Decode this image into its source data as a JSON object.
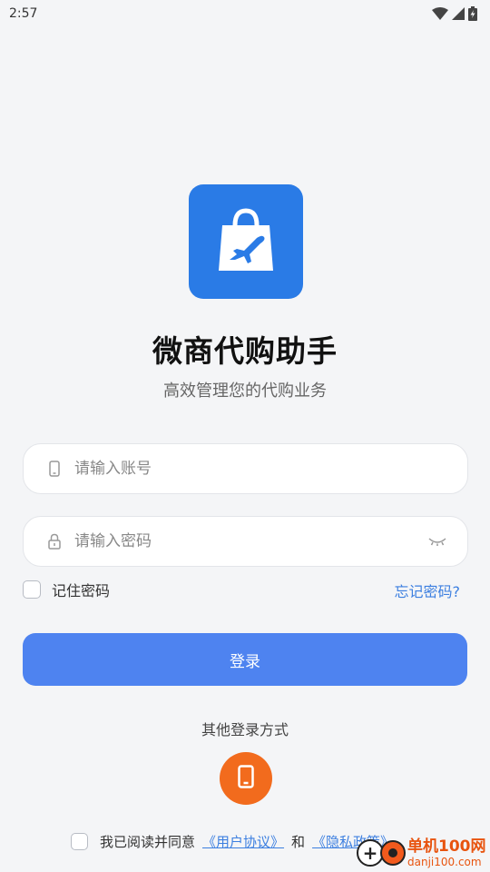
{
  "status_bar": {
    "time": "2:57",
    "icons": [
      "wifi-icon",
      "signal-icon",
      "battery-charging-icon"
    ]
  },
  "app": {
    "logo_icon": "shopping-bag-airplane-icon",
    "logo_color": "#2a7be6",
    "title": "微商代购助手",
    "subtitle": "高效管理您的代购业务"
  },
  "form": {
    "account": {
      "icon": "phone-icon",
      "placeholder": "请输入账号",
      "value": ""
    },
    "password": {
      "icon": "lock-icon",
      "placeholder": "请输入密码",
      "value": "",
      "toggle_icon": "eye-closed-icon"
    },
    "remember_label": "记住密码",
    "forgot_label": "忘记密码?",
    "login_label": "登录",
    "accent_color": "#4e83f0"
  },
  "other_login": {
    "title": "其他登录方式",
    "phone_icon": "phone-login-icon",
    "phone_color": "#f26b1d"
  },
  "agreement": {
    "prefix": "我已阅读并同意",
    "user_agreement": "《用户协议》",
    "and": "和",
    "privacy_policy": "《隐私政策》"
  },
  "watermark": {
    "main": "单机100网",
    "sub": "danji100.com"
  }
}
